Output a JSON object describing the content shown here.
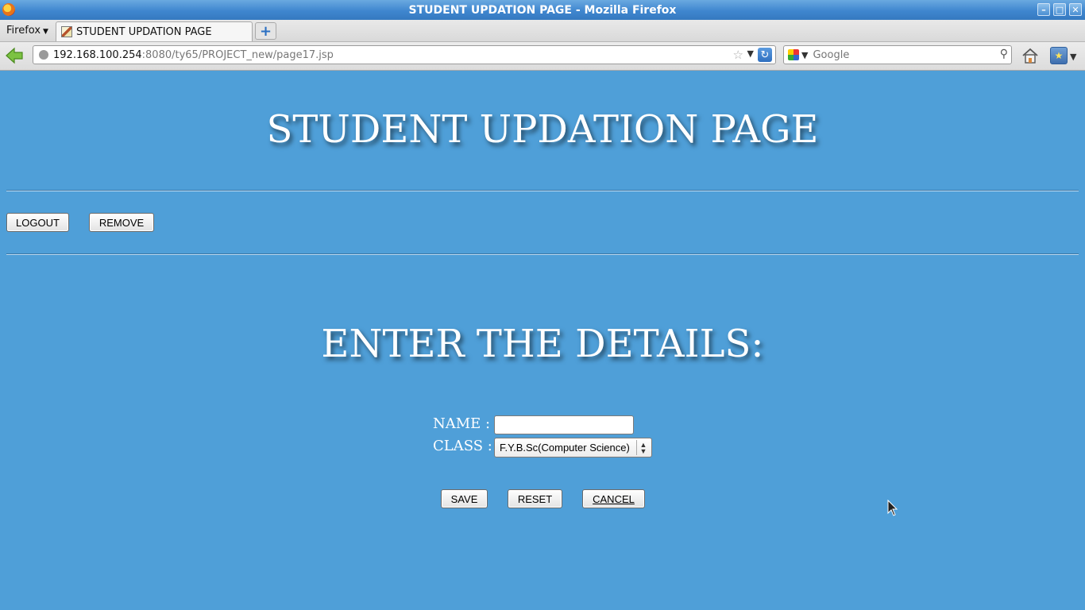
{
  "window": {
    "title": "STUDENT UPDATION PAGE - Mozilla Firefox"
  },
  "browser": {
    "menu_label": "Firefox",
    "tab_title": "STUDENT UPDATION PAGE",
    "url_host": "192.168.100.254",
    "url_rest": ":8080/ty65/PROJECT_new/page17.jsp",
    "search_placeholder": "Google"
  },
  "page": {
    "title": "STUDENT UPDATION PAGE",
    "logout_label": "LOGOUT",
    "remove_label": "REMOVE",
    "details_heading": "ENTER THE DETAILS:",
    "form": {
      "name_label": "NAME :",
      "name_value": "",
      "class_label": "CLASS :",
      "class_selected": "F.Y.B.Sc(Computer Science)",
      "save_label": "SAVE",
      "reset_label": "RESET",
      "cancel_label": "CANCEL"
    }
  },
  "colors": {
    "page_background": "#4f9fd8",
    "titlebar": "#3f86cf",
    "heading_text": "#ffffff"
  }
}
